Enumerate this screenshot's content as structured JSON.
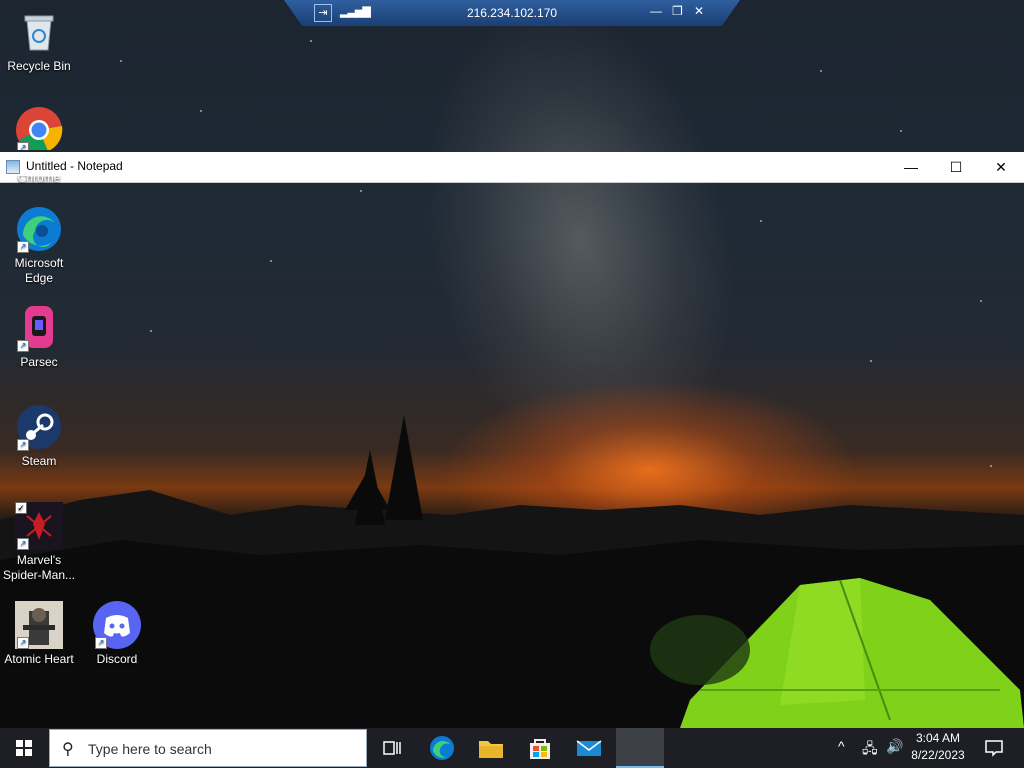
{
  "remote_bar": {
    "ip": "216.234.102.170"
  },
  "notepad": {
    "title": "Untitled - Notepad"
  },
  "desktop_icons": [
    {
      "label": "Recycle Bin",
      "icon": "recycle-bin-icon"
    },
    {
      "label": "Chrome",
      "icon": "chrome-icon"
    },
    {
      "label": "Microsoft Edge",
      "icon": "edge-icon"
    },
    {
      "label": "Parsec",
      "icon": "parsec-icon"
    },
    {
      "label": "Steam",
      "icon": "steam-icon"
    },
    {
      "label": "Marvel's Spider-Man...",
      "icon": "spiderman-icon"
    },
    {
      "label": "Atomic Heart",
      "icon": "atomic-heart-icon"
    },
    {
      "label": "Discord",
      "icon": "discord-icon"
    }
  ],
  "taskbar": {
    "search_placeholder": "Type here to search",
    "time": "3:04 AM",
    "date": "8/22/2023"
  },
  "colors": {
    "taskbar": "#1d1f24",
    "accent": "#0078d7",
    "tent": "#7fd11a"
  }
}
